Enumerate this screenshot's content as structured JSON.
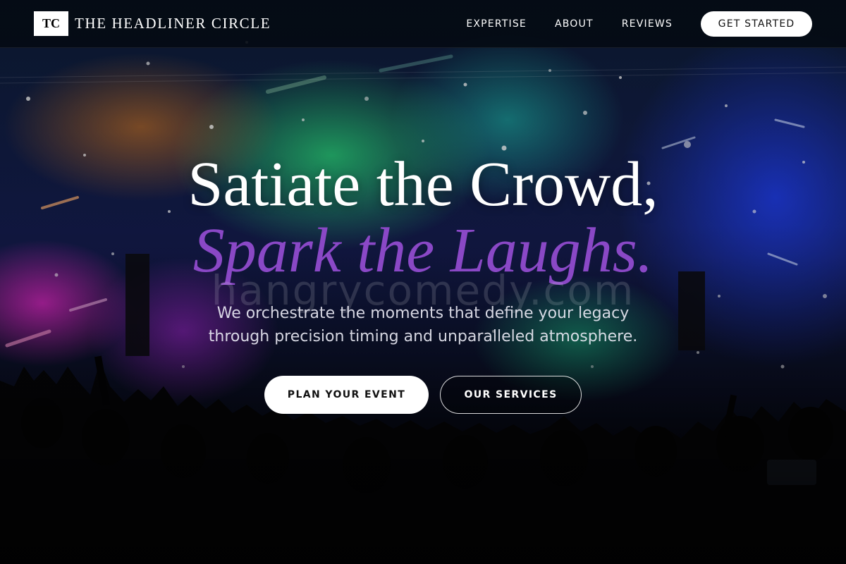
{
  "brand": {
    "logo_text": "TC",
    "name": "THE HEADLINER CIRCLE"
  },
  "nav": {
    "links": [
      {
        "label": "EXPERTISE"
      },
      {
        "label": "ABOUT"
      },
      {
        "label": "REVIEWS"
      }
    ],
    "cta_label": "GET STARTED"
  },
  "hero": {
    "headline": "Satiate the Crowd,",
    "headline_accent": "Spark the Laughs.",
    "watermark": "hangrycomedy.com",
    "subtitle_line1": "We orchestrate the moments that define your legacy",
    "subtitle_line2": "through precision timing and unparalleled atmosphere.",
    "primary_button": "PLAN YOUR EVENT",
    "secondary_button": "OUR SERVICES",
    "background_icon": "concert-crowd-image"
  },
  "colors": {
    "accent": "#8a48c6",
    "nav_bg": "#050a12",
    "button_bg": "#ffffff"
  }
}
